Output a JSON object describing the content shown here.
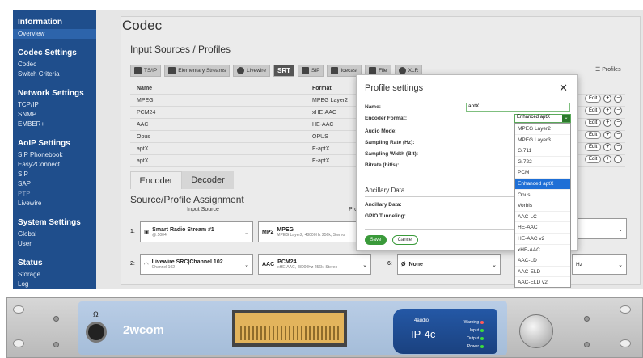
{
  "sidebar": {
    "groups": [
      {
        "title": "Information",
        "items": [
          "Overview"
        ]
      },
      {
        "title": "Codec Settings",
        "items": [
          "Codec",
          "Switch Criteria"
        ]
      },
      {
        "title": "Network Settings",
        "items": [
          "TCP/IP",
          "SNMP",
          "EMBER+"
        ]
      },
      {
        "title": "AoIP Settings",
        "items": [
          "SIP Phonebook",
          "Easy2Connect",
          "SIP",
          "SAP",
          "PTP",
          "Livewire"
        ]
      },
      {
        "title": "System Settings",
        "items": [
          "Global",
          "User"
        ]
      },
      {
        "title": "Status",
        "items": [
          "Storage",
          "Log"
        ]
      }
    ]
  },
  "main": {
    "title": "Codec",
    "input_sources_title": "Input Sources / Profiles",
    "source_tabs": [
      "TS/IP",
      "Elementary Streams",
      "Livewire",
      "SRT",
      "SIP",
      "Icecast",
      "File",
      "XLR"
    ],
    "profiles_label": "Profiles",
    "table": {
      "headers": [
        "Name",
        "Format"
      ],
      "rows": [
        [
          "MPEG",
          "MPEG Layer2"
        ],
        [
          "PCM24",
          "xHE-AAC"
        ],
        [
          "AAC",
          "HE-AAC"
        ],
        [
          "Opus",
          "OPUS"
        ],
        [
          "aptX",
          "E-aptX"
        ],
        [
          "aptX",
          "E-aptX"
        ]
      ],
      "edit_label": "Edit"
    },
    "tabs": [
      "Encoder",
      "Decoder"
    ],
    "assignment_title": "Source/Profile Assignment",
    "assignment_headers": [
      "Input Source",
      "Profile"
    ],
    "assignments": [
      {
        "num": "1:",
        "source": "Smart Radio Stream #1",
        "source_sub": "@:5004",
        "profile": "MPEG",
        "profile_sub": "MPEG Layer2, 48000Hz 256k, Stereo",
        "profile_badge": "MP2"
      },
      {
        "num": "2:",
        "source": "Livewire SRC|Channel 102",
        "source_sub": "Channel 102",
        "profile": "PCM24",
        "profile_sub": "xHE-AAC, 48000Hz 256k, Stereo",
        "profile_badge": "AAC"
      }
    ],
    "slot6": {
      "num": "6:",
      "value": "None"
    },
    "partial_right": "Hz"
  },
  "modal": {
    "title": "Profile settings",
    "fields": {
      "name_label": "Name:",
      "name_value": "aptX",
      "encoder_format_label": "Encoder Format:",
      "encoder_format_value": "Enhanced aptX",
      "audio_mode_label": "Audio Mode:",
      "sampling_rate_label": "Sampling Rate (Hz):",
      "sampling_width_label": "Sampling Width (Bit):",
      "bitrate_label": "Bitrate (bit/s):"
    },
    "ancillary_title": "Ancillary Data",
    "ancillary_label": "Ancillary Data:",
    "gpio_label": "GPIO Tunneling:",
    "save_label": "Save",
    "cancel_label": "Cancel"
  },
  "dropdown": {
    "options": [
      "MPEG Layer2",
      "MPEG Layer3",
      "G.711",
      "G.722",
      "PCM",
      "Enhanced aptX",
      "Opus",
      "Vorbis",
      "AAC-LC",
      "HE-AAC",
      "HE-AAC v2",
      "xHE-AAC",
      "AAC-LD",
      "AAC-ELD",
      "AAC-ELD v2"
    ],
    "selected": "Enhanced aptX"
  },
  "hardware": {
    "brand": "2wcom",
    "model_brand": "4audio",
    "model": "IP-4c",
    "indicators": [
      "Warning",
      "Input",
      "Output",
      "Power"
    ],
    "indicator_colors": [
      "#ff5a5a",
      "#3cdc3c",
      "#3cdc3c",
      "#3cdc3c"
    ],
    "headphone_symbol": "Ω"
  }
}
